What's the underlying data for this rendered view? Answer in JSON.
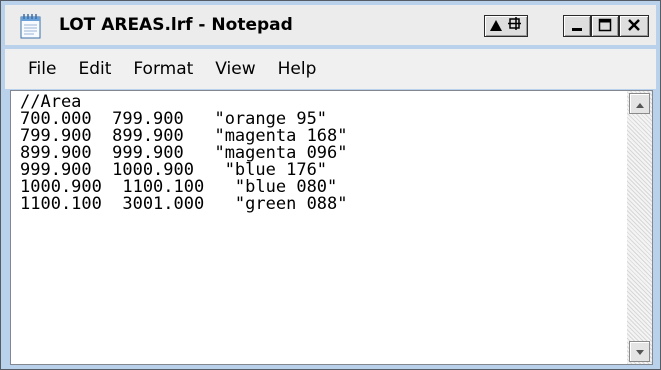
{
  "window": {
    "title": "LOT AREAS.lrf - Notepad",
    "icon": "notepad-icon"
  },
  "title_buttons": [
    "restore-down-icon",
    "pin-icon",
    "minimize-icon",
    "maximize-icon",
    "close-icon"
  ],
  "menu": {
    "items": [
      {
        "label": "File"
      },
      {
        "label": "Edit"
      },
      {
        "label": "Format"
      },
      {
        "label": "View"
      },
      {
        "label": "Help"
      }
    ]
  },
  "editor": {
    "text": "//Area\n700.000  799.900   \"orange 95\"\n799.900  899.900   \"magenta 168\"\n899.900  999.900   \"magenta 096\"\n999.900  1000.900   \"blue 176\"\n1000.900  1100.100   \"blue 080\"\n1100.100  3001.000   \"green 088\""
  },
  "scrollbar": {
    "up_icon": "scroll-up-arrow-icon",
    "down_icon": "scroll-down-arrow-icon"
  },
  "colors": {
    "window_frame": "#b9d1ea",
    "title_text": "#000000",
    "editor_bg": "#ffffff"
  }
}
